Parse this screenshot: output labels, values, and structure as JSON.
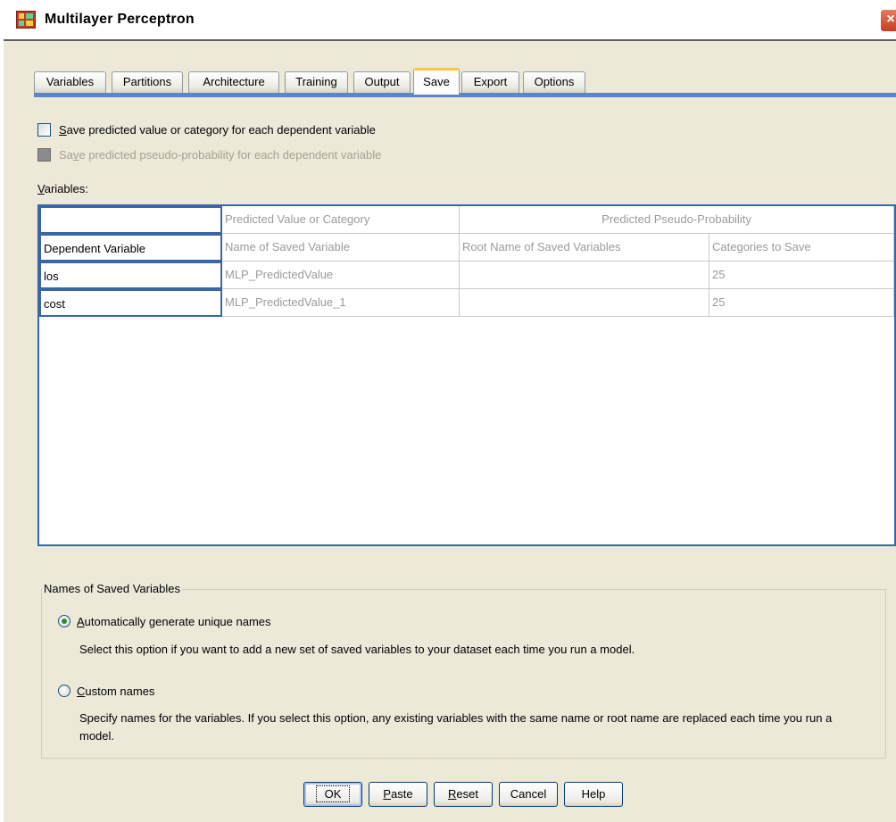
{
  "window": {
    "title": "Multilayer Perceptron",
    "close_label": "×",
    "colors": {
      "tab_rule": "#5b88c4",
      "active_tab_top": "#ffc83c",
      "radio_selected": "#2f8a2f",
      "close": "#c4401e"
    }
  },
  "tabs": [
    {
      "label": "Variables"
    },
    {
      "label": "Partitions"
    },
    {
      "label": "Architecture"
    },
    {
      "label": "Training"
    },
    {
      "label": "Output"
    },
    {
      "label": "Save",
      "active": true
    },
    {
      "label": "Export"
    },
    {
      "label": "Options"
    }
  ],
  "checkboxes": {
    "predicted_value": {
      "label_first": "S",
      "label_rest": "ave predicted value or category for each dependent variable",
      "checked": false
    },
    "pseudo_probability": {
      "label_first": "Sa",
      "label_underlined": "v",
      "label_rest": "e predicted pseudo-probability for each dependent variable",
      "checked": false,
      "disabled": true
    }
  },
  "variables": {
    "label_first": "V",
    "label_rest": "ariables:",
    "header_row_1": [
      "",
      "Predicted Value or Category",
      "Predicted Pseudo-Probability"
    ],
    "header_row_2": [
      "Dependent Variable",
      "Name of Saved Variable",
      "Root Name of Saved Variables",
      "Categories to Save"
    ],
    "rows": [
      [
        "los",
        "MLP_PredictedValue",
        "",
        "25"
      ],
      [
        "cost",
        "MLP_PredictedValue_1",
        "",
        "25"
      ]
    ]
  },
  "names_group": {
    "legend": "Names of Saved Variables",
    "auto": {
      "label_first": "A",
      "label_rest": "utomatically generate unique names",
      "selected": true,
      "description": "Select this option if you want to add a new set of saved variables to your dataset each time you run a model."
    },
    "custom": {
      "label_first": "C",
      "label_rest": "ustom names",
      "selected": false,
      "description": "Specify names for the variables. If you select this option, any existing variables with the same name or root name are replaced each time you run a model."
    }
  },
  "buttons": {
    "ok": "OK",
    "paste_first": "P",
    "paste_rest": "aste",
    "reset_first": "R",
    "reset_rest": "eset",
    "cancel": "Cancel",
    "help": "Help"
  }
}
